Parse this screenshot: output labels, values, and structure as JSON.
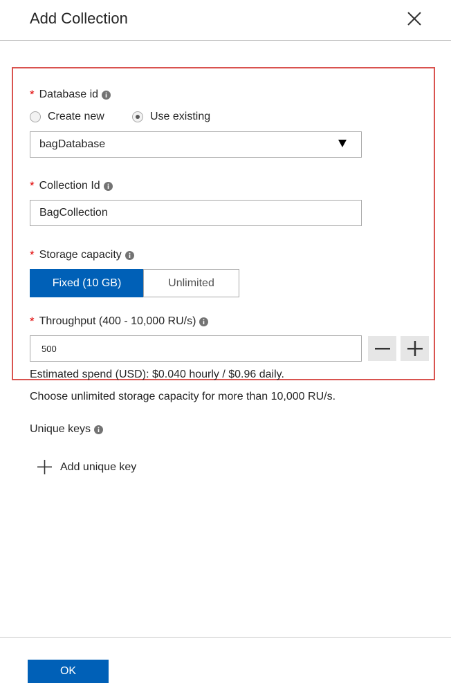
{
  "header": {
    "title": "Add Collection"
  },
  "database": {
    "label": "Database id",
    "options": {
      "create_new": "Create new",
      "use_existing": "Use existing"
    },
    "selected_value": "bagDatabase"
  },
  "collection": {
    "label": "Collection Id",
    "value": "BagCollection"
  },
  "storage": {
    "label": "Storage capacity",
    "fixed": "Fixed (10 GB)",
    "unlimited": "Unlimited"
  },
  "throughput": {
    "label": "Throughput (400 - 10,000 RU/s)",
    "value": "500",
    "estimate": "Estimated spend (USD): $0.040 hourly / $0.96 daily.",
    "hint": "Choose unlimited storage capacity for more than 10,000 RU/s."
  },
  "unique_keys": {
    "label": "Unique keys",
    "add_label": "Add unique key"
  },
  "footer": {
    "ok_label": "OK"
  },
  "colors": {
    "accent": "#0060b7",
    "required": "#e00000",
    "highlight_border": "#d9534f"
  }
}
